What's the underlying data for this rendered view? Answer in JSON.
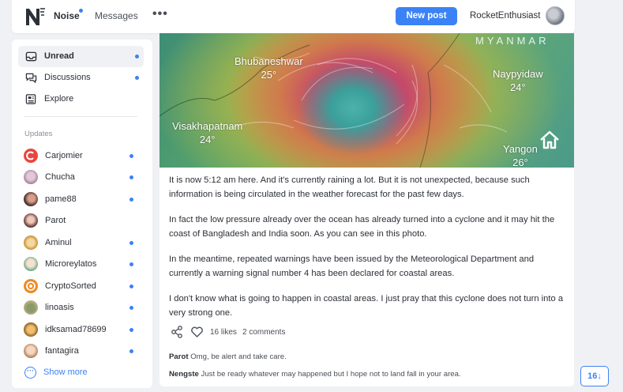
{
  "topbar": {
    "tabs": [
      {
        "label": "Noise",
        "has_dot": true
      },
      {
        "label": "Messages"
      }
    ],
    "more_label": "•••",
    "new_post_label": "New post",
    "username": "RocketEnthusiast"
  },
  "sidebar": {
    "nav": [
      {
        "label": "Unread",
        "icon": "inbox-icon",
        "active": true,
        "dot": true
      },
      {
        "label": "Discussions",
        "icon": "chat-icon",
        "dot": true
      },
      {
        "label": "Explore",
        "icon": "newspaper-icon"
      }
    ],
    "updates_title": "Updates",
    "updates": [
      {
        "name": "Carjomier",
        "color": "#e8463e"
      },
      {
        "name": "Chucha",
        "color": "#b89ab8"
      },
      {
        "name": "pame88",
        "color": "#4a2a2a"
      },
      {
        "name": "Parot",
        "color": "#c89090"
      },
      {
        "name": "Aminul",
        "color": "#e0b060"
      },
      {
        "name": "Microreylatos",
        "color": "#9cc8a8"
      },
      {
        "name": "CryptoSorted",
        "color": "#f08a24"
      },
      {
        "name": "linoasis",
        "color": "#b8a070"
      },
      {
        "name": "idksamad78699",
        "color": "#c8902c"
      },
      {
        "name": "fantagira",
        "color": "#d8a888"
      }
    ],
    "show_more_label": "Show more"
  },
  "post": {
    "map": {
      "country": "MYANMAR",
      "cities": [
        {
          "name": "Bhubaneshwar",
          "temp": "25°"
        },
        {
          "name": "Naypyidaw",
          "temp": "24°"
        },
        {
          "name": "Visakhapatnam",
          "temp": "24°"
        },
        {
          "name": "Yangon",
          "temp": "26°"
        }
      ]
    },
    "paragraphs": [
      "It is now 5:12 am here. And it's currently raining a lot. But it is not unexpected, because such information is being circulated in the weather forecast for the past few days.",
      "In fact the low pressure already over the ocean has already turned into a cyclone and it may hit the coast of Bangladesh and India soon. As you can see in this photo.",
      "In the meantime, repeated warnings have been issued by the Meteorological Department and currently a warning signal number 4 has been declared for coastal areas.",
      "I don't know what is going to happen in coastal areas. I just pray that this cyclone does not turn into a very strong one."
    ],
    "likes": "16 likes",
    "comments_count": "2 comments",
    "comments": [
      {
        "author": "Parot",
        "text": "Omg, be alert and take care."
      },
      {
        "author": "Nengste",
        "text": "Just be ready whatever may happened but I hope not to land fall in your area."
      }
    ]
  },
  "page_badge": "16↓",
  "colors": {
    "accent": "#3b82f6",
    "background": "#f0f1f4"
  }
}
